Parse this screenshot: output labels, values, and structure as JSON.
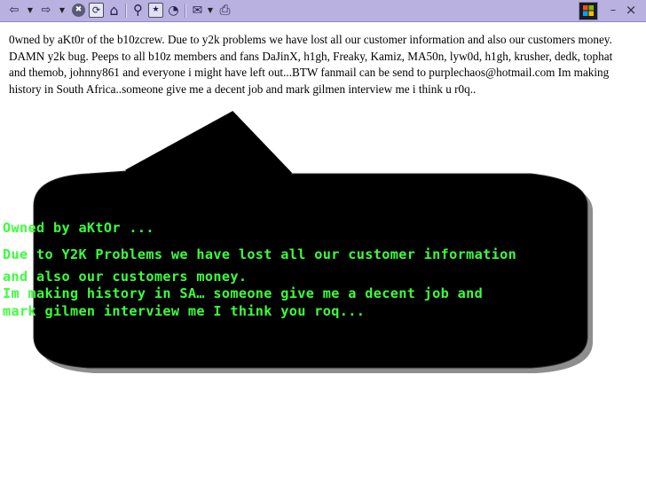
{
  "toolbar": {
    "buttons": [
      {
        "icon": "back-arrow-icon",
        "glyph": "⇦"
      },
      {
        "icon": "back-dropdown-icon",
        "glyph": "▼"
      },
      {
        "icon": "forward-arrow-icon",
        "glyph": "⇨"
      },
      {
        "icon": "forward-dropdown-icon",
        "glyph": "▼"
      },
      {
        "icon": "stop-icon",
        "glyph": "✖"
      },
      {
        "icon": "refresh-icon",
        "glyph": "⟳"
      },
      {
        "icon": "home-icon",
        "glyph": "⌂"
      },
      {
        "icon": "search-icon",
        "glyph": "⚲"
      },
      {
        "icon": "favorites-icon",
        "glyph": "★"
      },
      {
        "icon": "history-icon",
        "glyph": "◔"
      },
      {
        "icon": "mail-icon",
        "glyph": "✉"
      },
      {
        "icon": "mail-dropdown-icon",
        "glyph": "▼"
      },
      {
        "icon": "print-icon",
        "glyph": "⎙"
      }
    ],
    "window_controls": {
      "minimize": "–",
      "close": "×"
    }
  },
  "page": {
    "paragraph": "0wned by aKt0r of the b10zcrew. Due to y2k problems we have lost all our customer information and also our customers money. DAMN y2k bug. Peeps to all b10z members and fans DaJinX, h1gh, Freaky, Kamiz, MA50n, lyw0d, h1gh, krusher, dedk, tophat and themob, johnny861 and everyone i might have left out...BTW fanmail can be send to purplechaos@hotmail.com Im making history in South Africa..someone give me a decent job and mark gilmen interview me i think u r0q.."
  },
  "bubble": {
    "lines": [
      "Owned by aKtOr ...",
      "Due to Y2K Problems we have lost all our customer information",
      "and also our customers money.",
      "Im making history in SA… someone give me a decent job and",
      "mark gilmen interview me I think you roq..."
    ]
  },
  "colors": {
    "toolbar_bg": "#b9b1e0",
    "bubble_fill": "#000000",
    "bubble_text": "#3cff3c"
  }
}
